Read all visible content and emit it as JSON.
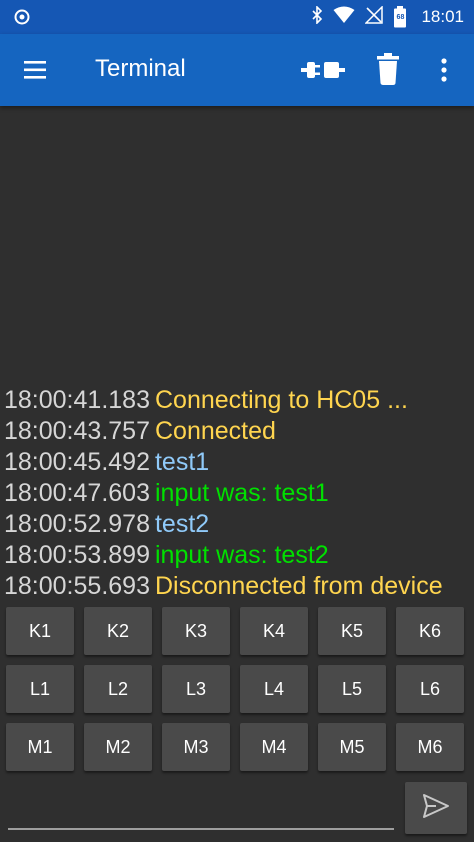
{
  "status_bar": {
    "time": "18:01",
    "battery_level": "68",
    "icons": [
      "radio-icon",
      "bluetooth-icon",
      "wifi-icon",
      "no-signal-icon",
      "battery-icon"
    ]
  },
  "app_bar": {
    "title": "Terminal",
    "icons": [
      "menu-icon",
      "connect-icon",
      "delete-icon",
      "more-vert-icon"
    ]
  },
  "terminal": {
    "colors": {
      "timestamp": "#d6d6d6",
      "status": "#ffd54f",
      "sent": "#90caf9",
      "received": "#00e000"
    },
    "lines": [
      {
        "time": "18:00:41.183",
        "text": "Connecting to HC05 ...",
        "kind": "status"
      },
      {
        "time": "18:00:43.757",
        "text": "Connected",
        "kind": "status"
      },
      {
        "time": "18:00:45.492",
        "text": "test1",
        "kind": "sent"
      },
      {
        "time": "18:00:47.603",
        "text": "input was: test1",
        "kind": "received"
      },
      {
        "time": "18:00:52.978",
        "text": "test2",
        "kind": "sent"
      },
      {
        "time": "18:00:53.899",
        "text": "input was: test2",
        "kind": "received"
      },
      {
        "time": "18:00:55.693",
        "text": "Disconnected from device",
        "kind": "status"
      }
    ]
  },
  "buttons": [
    [
      "K1",
      "K2",
      "K3",
      "K4",
      "K5",
      "K6"
    ],
    [
      "L1",
      "L2",
      "L3",
      "L4",
      "L5",
      "L6"
    ],
    [
      "M1",
      "M2",
      "M3",
      "M4",
      "M5",
      "M6"
    ]
  ],
  "input": {
    "value": "",
    "placeholder": "",
    "send_icon": "send-icon"
  }
}
